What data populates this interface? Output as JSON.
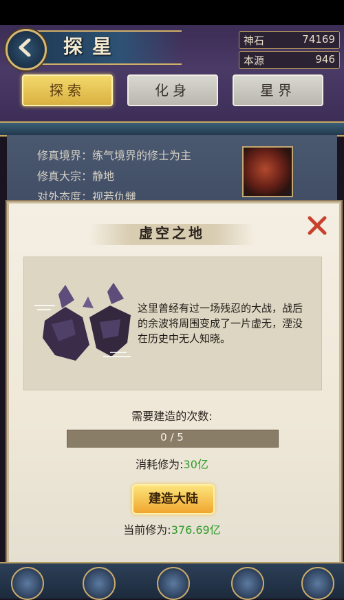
{
  "header": {
    "title": "探星",
    "resources": [
      {
        "label": "神石",
        "value": "74169"
      },
      {
        "label": "本源",
        "value": "946"
      }
    ],
    "tabs": [
      {
        "label": "探索",
        "active": true
      },
      {
        "label": "化身",
        "active": false
      },
      {
        "label": "星界",
        "active": false
      }
    ]
  },
  "info": {
    "lines": [
      "修真境界：练气境界的修士为主",
      "修真大宗：静地",
      "对外态度：视若仇雠"
    ]
  },
  "modal": {
    "title": "虚空之地",
    "description": "这里曾经有过一场残忍的大战，战后的余波将周围变成了一片虚无，湮没在历史中无人知晓。",
    "build_count_label": "需要建造的次数:",
    "progress": {
      "current": 0,
      "total": 5,
      "text": "0 / 5"
    },
    "cost_label": "消耗修为:",
    "cost_value": "30亿",
    "build_button": "建造大陆",
    "current_label": "当前修为:",
    "current_value": "376.69亿"
  },
  "colors": {
    "accent_gold": "#d9b142",
    "value_green": "#2f9a2a",
    "close_red": "#c8412c"
  }
}
